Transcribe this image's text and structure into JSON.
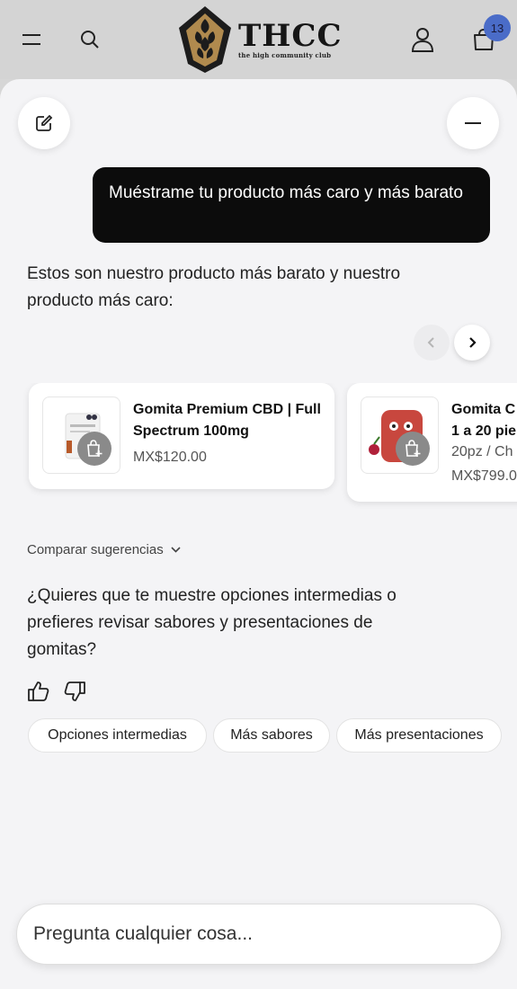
{
  "header": {
    "logo_name": "THCC",
    "logo_tagline": "the high community club",
    "cart_count": "13"
  },
  "chat": {
    "user_message": "Muéstrame tu producto más caro y más barato",
    "assistant_intro": "Estos son nuestro producto más barato y nuestro producto más caro:",
    "products": [
      {
        "name": "Gomita Premium CBD | Full Spectrum 100mg",
        "price": "MX$120.00"
      },
      {
        "name": "Gomita C",
        "name_line2": "1 a 20 pie",
        "variant": "20pz / Ch",
        "price": "MX$799.0"
      }
    ],
    "compare_label": "Comparar sugerencias",
    "question": "¿Quieres que te muestre opciones intermedias o prefieres revisar sabores y presentaciones de gomitas?",
    "suggestions": [
      "Opciones intermedias",
      "Más sabores",
      "Más presentaciones"
    ]
  },
  "input": {
    "placeholder": "Pregunta cualquier cosa..."
  },
  "colors": {
    "badge": "#4a6cc8",
    "user_bubble": "#0c0c0c",
    "logo_gold": "#b08a4e"
  },
  "icons": [
    "menu-icon",
    "search-icon",
    "user-icon",
    "bag-icon",
    "edit-icon",
    "minus-icon",
    "chevron-left-icon",
    "chevron-right-icon",
    "add-to-cart-icon",
    "chevron-down-icon",
    "thumbs-up-icon",
    "thumbs-down-icon"
  ]
}
